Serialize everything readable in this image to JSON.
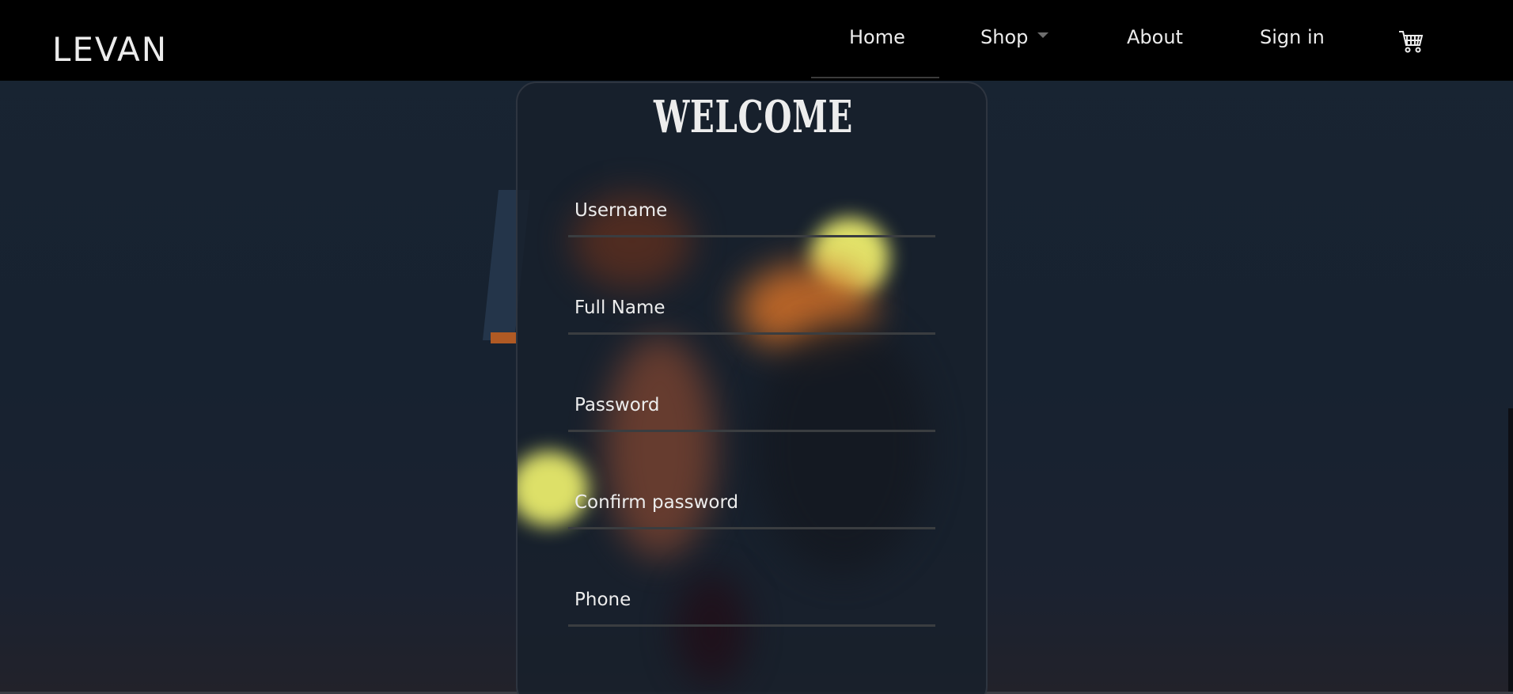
{
  "brand": "LEVAN",
  "nav": {
    "home": "Home",
    "shop": "Shop",
    "about": "About",
    "sign_in": "Sign in",
    "cart_icon": "cart-icon"
  },
  "form": {
    "title": "WELCOME",
    "fields": [
      {
        "placeholder": "Username",
        "value": ""
      },
      {
        "placeholder": "Full Name",
        "value": ""
      },
      {
        "placeholder": "Password",
        "value": ""
      },
      {
        "placeholder": "Confirm password",
        "value": ""
      },
      {
        "placeholder": "Phone",
        "value": ""
      }
    ]
  },
  "colors": {
    "navbar": "#000000",
    "background": "#172230",
    "text": "#e6e6e6",
    "field_line": "#3a3d40"
  }
}
